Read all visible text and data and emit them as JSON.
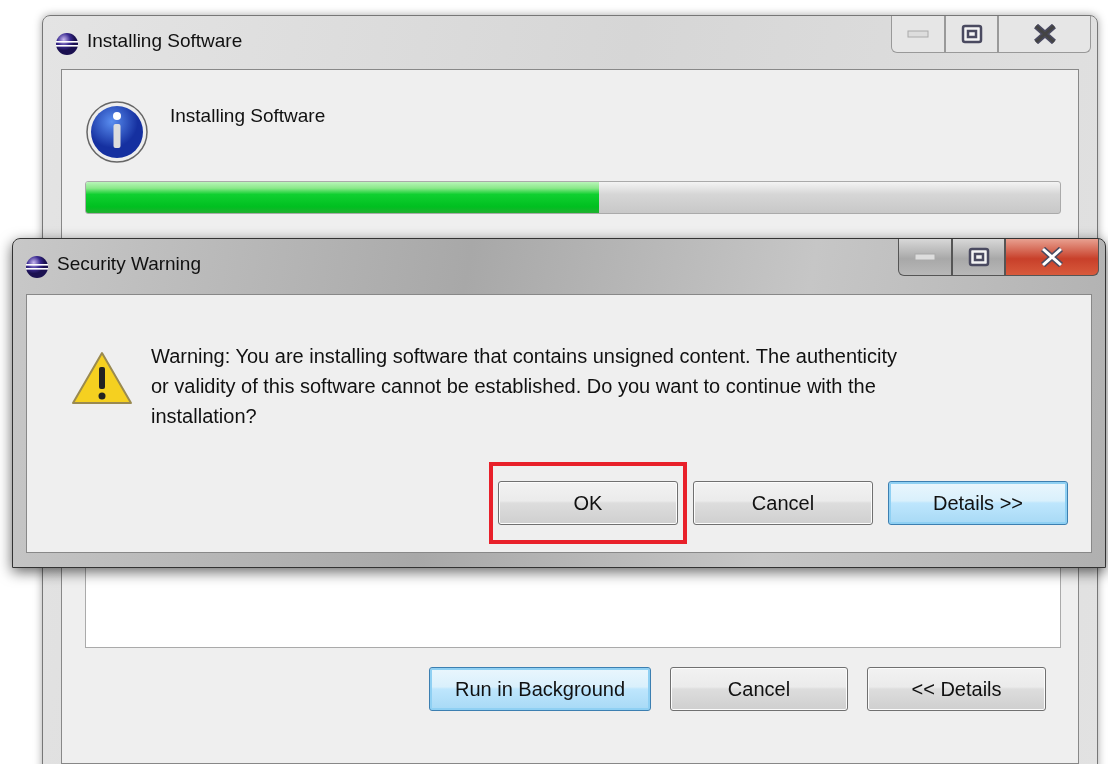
{
  "background_window": {
    "title": "Installing Software",
    "active": false,
    "heading": "Installing Software",
    "progress": {
      "level": 0.527
    },
    "buttons": [
      {
        "label": "Run in Background",
        "default": true
      },
      {
        "label": "Cancel",
        "default": false
      },
      {
        "label": "<< Details",
        "default": false
      }
    ]
  },
  "dialog": {
    "title": "Security Warning",
    "active": true,
    "message": "Warning: You are installing software that contains unsigned content. The authenticity or validity of this software cannot be established. Do you want to continue with the installation?",
    "buttons": [
      {
        "label": "OK",
        "default": false,
        "highlighted": true
      },
      {
        "label": "Cancel",
        "default": false,
        "highlighted": false
      },
      {
        "label": "Details >>",
        "default": true,
        "highlighted": false
      }
    ]
  }
}
